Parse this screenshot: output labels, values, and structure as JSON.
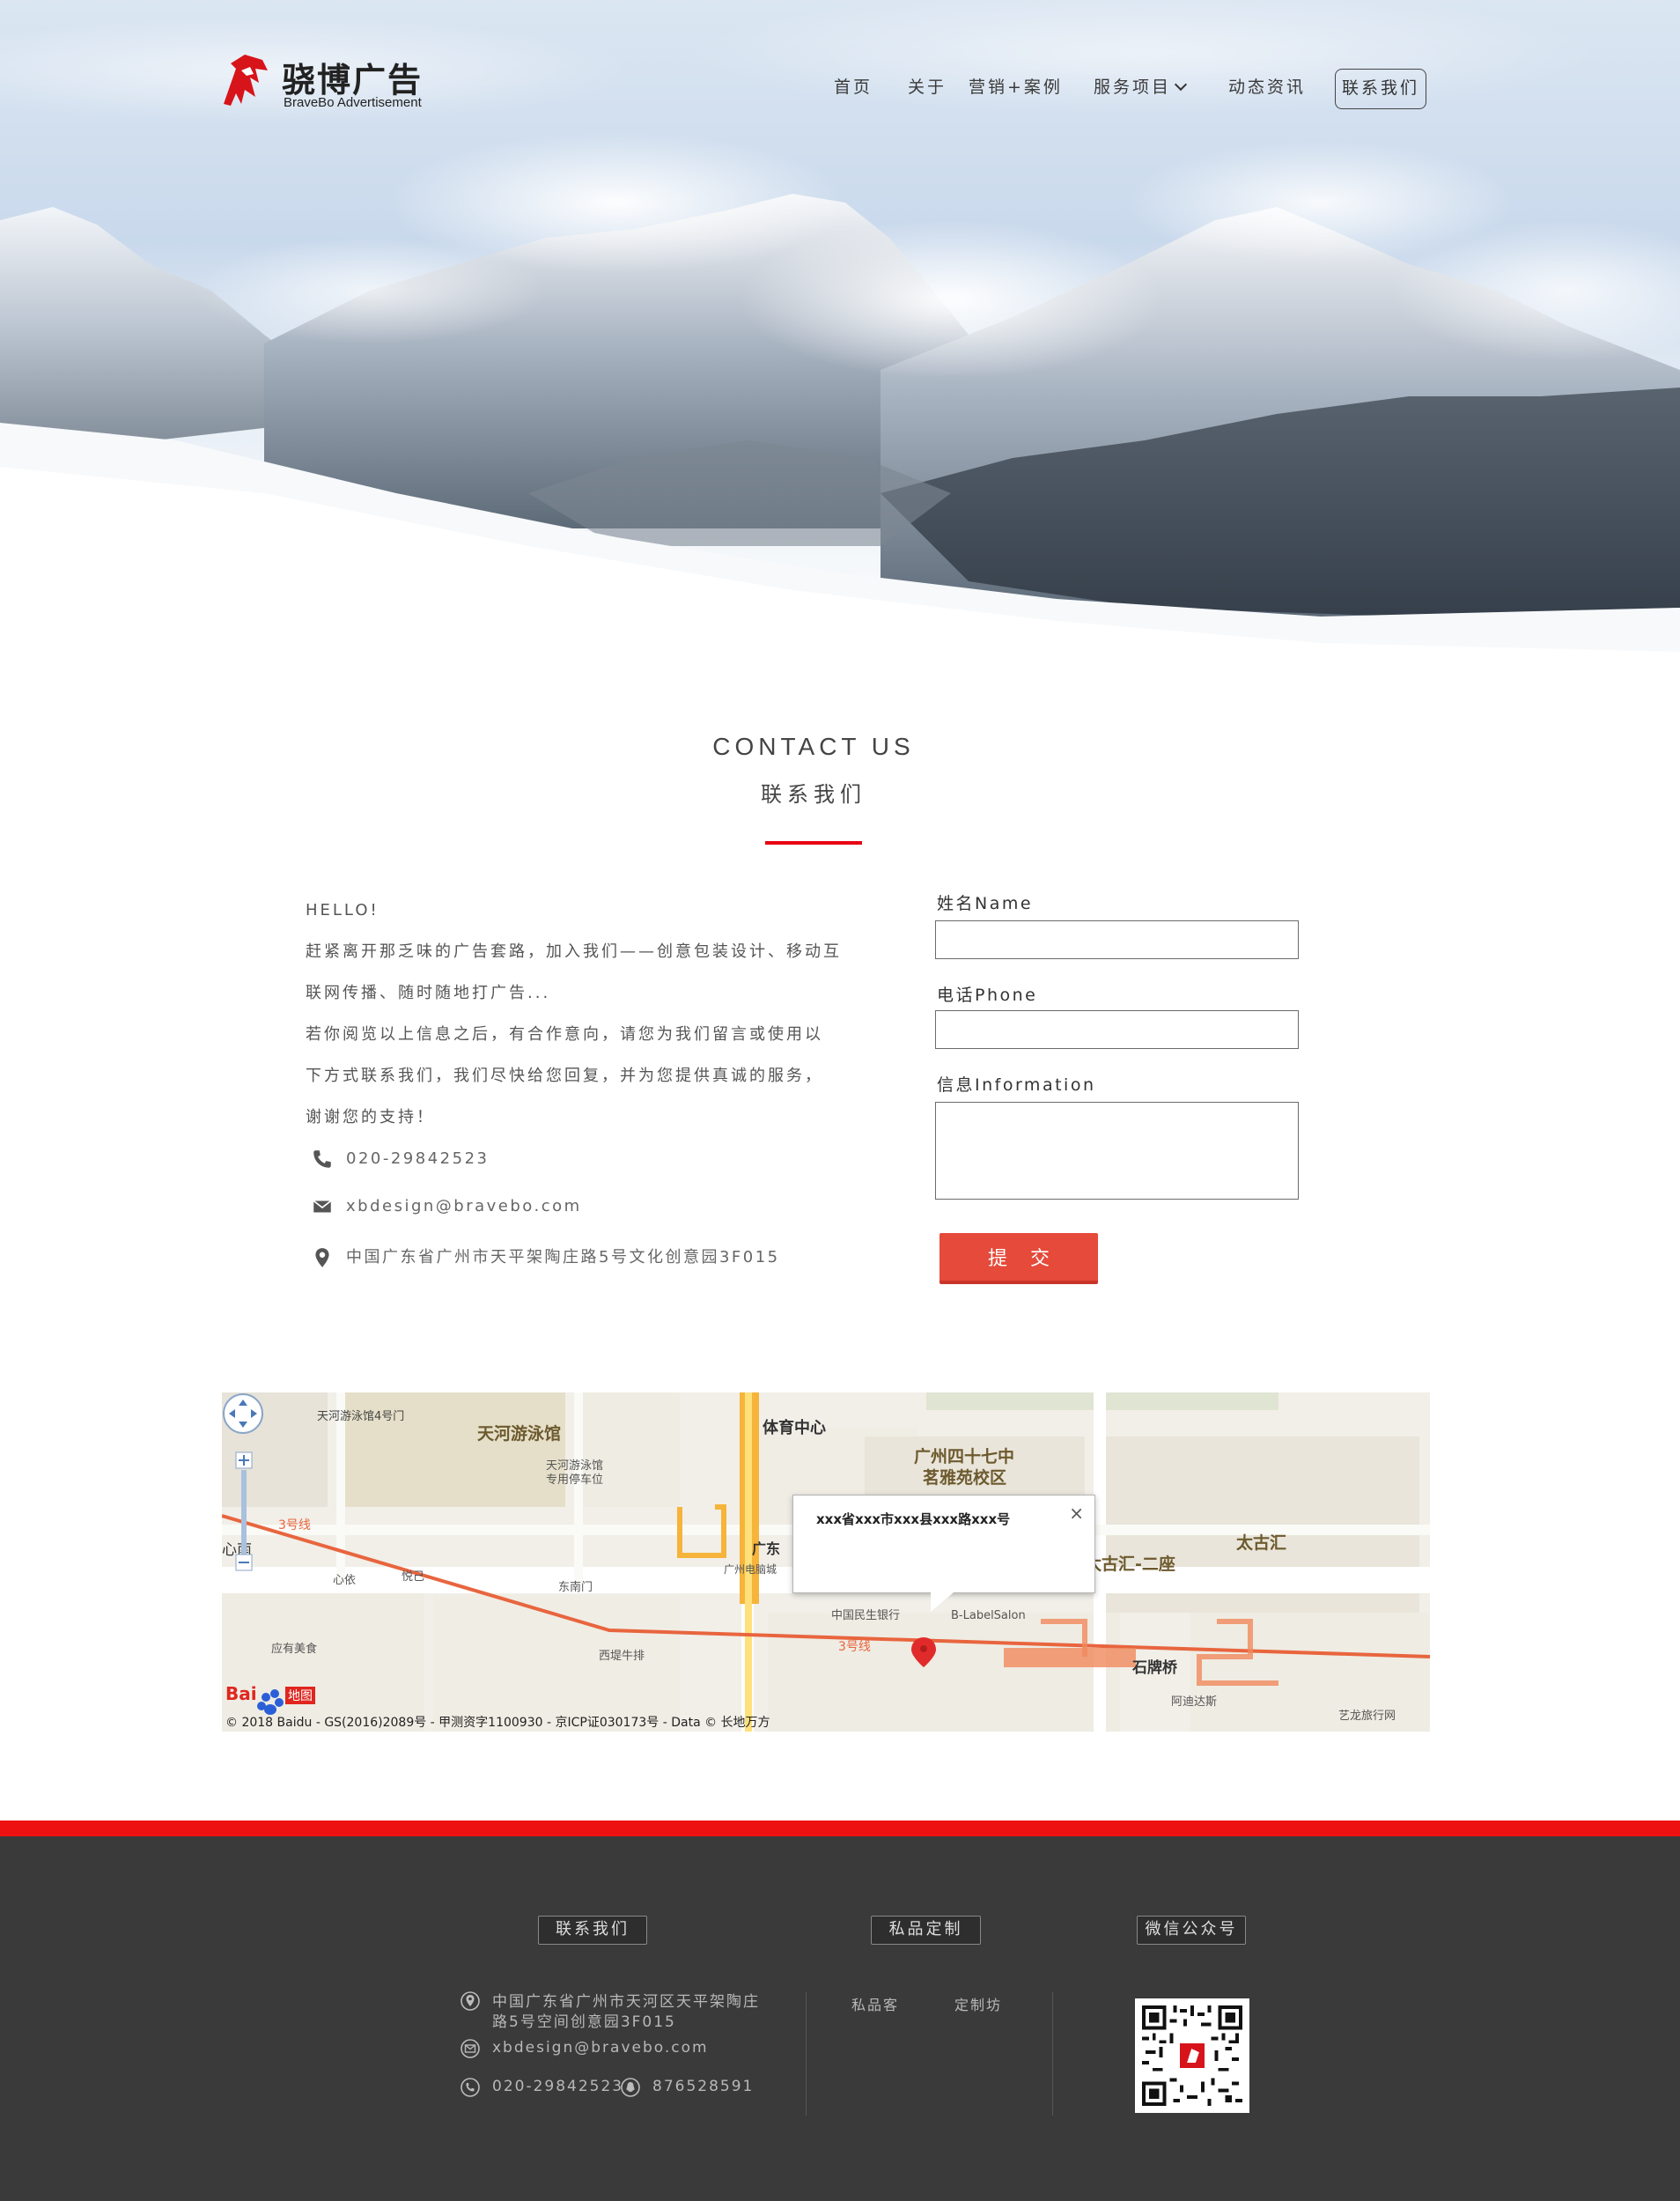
{
  "brand": {
    "name_cn": "骁博广告",
    "name_en": "BraveBo Advertisement",
    "accent": "#e60012"
  },
  "nav": {
    "items": [
      {
        "label": "首页"
      },
      {
        "label": "关于"
      },
      {
        "label": "营销+案例"
      },
      {
        "label": "服务项目"
      },
      {
        "label": "动态资讯"
      }
    ],
    "contact_label": "联系我们"
  },
  "contact": {
    "title_en": "CONTACT US",
    "title_cn": "联系我们",
    "intro": [
      "HELLO!",
      "赶紧离开那乏味的广告套路，加入我们——创意包装设计、移动互",
      "联网传播、随时随地打广告...",
      "若你阅览以上信息之后，有合作意向，请您为我们留言或使用以",
      "下方式联系我们，我们尽快给您回复，并为您提供真诚的服务，",
      "谢谢您的支持！"
    ],
    "phone": "020-29842523",
    "email": "xbdesign@bravebo.com",
    "address": "中国广东省广州市天平架陶庄路5号文化创意园3F015"
  },
  "form": {
    "name_label": "姓名Name",
    "name_value": "",
    "phone_label": "电话Phone",
    "phone_value": "",
    "info_label": "信息Information",
    "info_value": "",
    "submit_label": "提交"
  },
  "map": {
    "popup_text": "xxx省xxx市xxx县xxx路xxx号",
    "close_symbol": "×",
    "labels": {
      "swim_gate": "天河游泳馆4号门",
      "swim": "天河游泳馆",
      "swim_parking_1": "天河游泳馆",
      "swim_parking_2": "专用停车位",
      "sports_center": "体育中心",
      "school_1": "广州四十七中",
      "school_2": "茗雅苑校区",
      "taiguhui": "太古汇",
      "taiguhui2": "太古汇-二座",
      "line3_a": "3号线",
      "line3_b": "3号线",
      "xinan": "心南",
      "xinyi": "心依",
      "yuebaguo": "悦己",
      "dongnanmen": "东南门",
      "gd": "广东",
      "pc_city": "广州电脑城",
      "cmbc": "中国民生银行",
      "blabel": "B-LabelSalon",
      "shipaiqiao": "石牌桥",
      "yingyoumeishi": "应有美食",
      "xidi": "西堤牛排",
      "adidas": "阿迪达斯",
      "yilong": "艺龙旅行网",
      "baidu_logo": "Bai",
      "baidu_logo2": "地图",
      "copyright": "© 2018 Baidu - GS(2016)2089号 - 甲测资字1100930 - 京ICP证030173号 - Data © 长地万方"
    }
  },
  "footer": {
    "col1_title": "联系我们",
    "col2_title": "私品定制",
    "col3_title": "微信公众号",
    "address_line1": "中国广东省广州市天河区天平架陶庄",
    "address_line2": "路5号空间创意园3F015",
    "email": "xbdesign@bravebo.com",
    "phone": "020-29842523",
    "qq": "876528591",
    "links": [
      "私品客",
      "定制坊"
    ],
    "bar_color": "#ee1111",
    "bg_color": "#3a3a3a"
  }
}
